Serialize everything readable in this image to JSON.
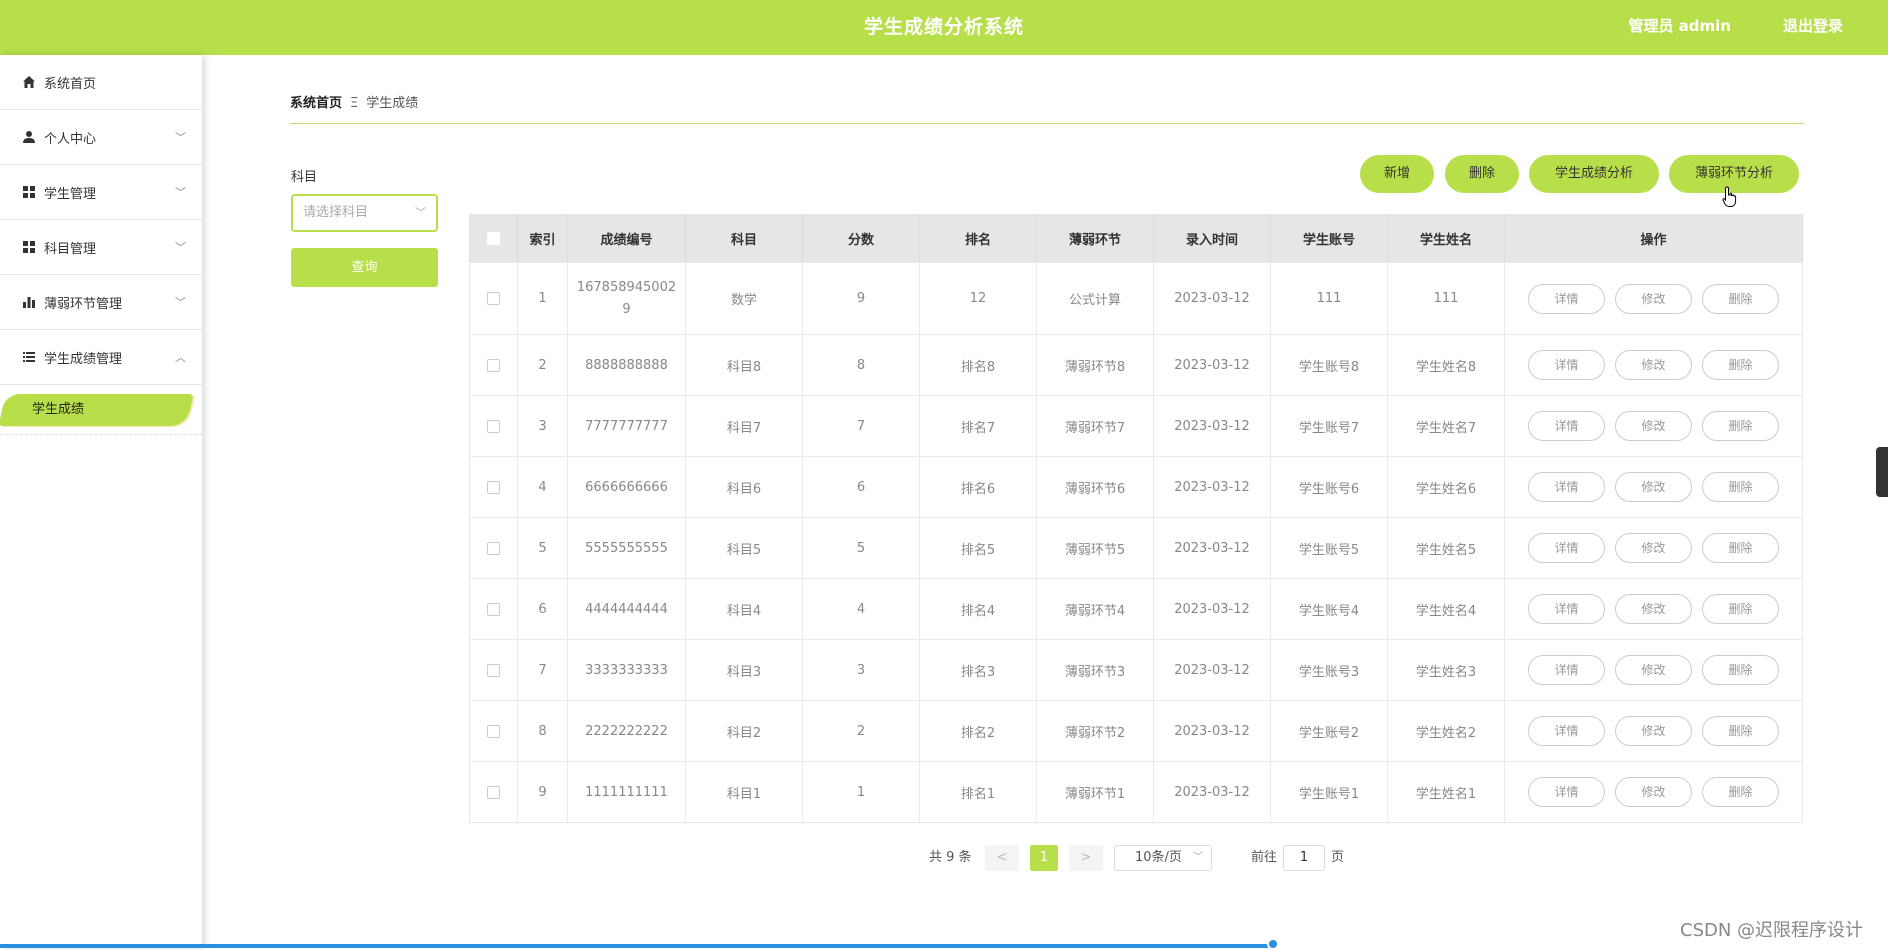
{
  "header": {
    "title": "学生成绩分析系统",
    "user": "管理员 admin",
    "logout": "退出登录"
  },
  "sidebar": {
    "items": [
      {
        "label": "系统首页"
      },
      {
        "label": "个人中心"
      },
      {
        "label": "学生管理"
      },
      {
        "label": "科目管理"
      },
      {
        "label": "薄弱环节管理"
      },
      {
        "label": "学生成绩管理"
      }
    ],
    "active_sub": "学生成绩"
  },
  "breadcrumb": {
    "home": "系统首页",
    "sep": "Ξ",
    "current": "学生成绩"
  },
  "filter": {
    "label": "科目",
    "placeholder": "请选择科目",
    "query": "查询"
  },
  "actions": {
    "add": "新增",
    "delete": "删除",
    "analysis": "学生成绩分析",
    "weak": "薄弱环节分析"
  },
  "table": {
    "columns": [
      "索引",
      "成绩编号",
      "科目",
      "分数",
      "排名",
      "薄弱环节",
      "录入时间",
      "学生账号",
      "学生姓名",
      "操作"
    ],
    "row_actions": {
      "detail": "详情",
      "edit": "修改",
      "delete": "删除"
    },
    "rows": [
      [
        "1",
        "1678589450029",
        "数学",
        "9",
        "12",
        "公式计算",
        "2023-03-12",
        "111",
        "111"
      ],
      [
        "2",
        "8888888888",
        "科目8",
        "8",
        "排名8",
        "薄弱环节8",
        "2023-03-12",
        "学生账号8",
        "学生姓名8"
      ],
      [
        "3",
        "7777777777",
        "科目7",
        "7",
        "排名7",
        "薄弱环节7",
        "2023-03-12",
        "学生账号7",
        "学生姓名7"
      ],
      [
        "4",
        "6666666666",
        "科目6",
        "6",
        "排名6",
        "薄弱环节6",
        "2023-03-12",
        "学生账号6",
        "学生姓名6"
      ],
      [
        "5",
        "5555555555",
        "科目5",
        "5",
        "排名5",
        "薄弱环节5",
        "2023-03-12",
        "学生账号5",
        "学生姓名5"
      ],
      [
        "6",
        "4444444444",
        "科目4",
        "4",
        "排名4",
        "薄弱环节4",
        "2023-03-12",
        "学生账号4",
        "学生姓名4"
      ],
      [
        "7",
        "3333333333",
        "科目3",
        "3",
        "排名3",
        "薄弱环节3",
        "2023-03-12",
        "学生账号3",
        "学生姓名3"
      ],
      [
        "8",
        "2222222222",
        "科目2",
        "2",
        "排名2",
        "薄弱环节2",
        "2023-03-12",
        "学生账号2",
        "学生姓名2"
      ],
      [
        "9",
        "1111111111",
        "科目1",
        "1",
        "排名1",
        "薄弱环节1",
        "2023-03-12",
        "学生账号1",
        "学生姓名1"
      ]
    ]
  },
  "pagination": {
    "total": "共 9 条",
    "prev": "<",
    "page": "1",
    "next": ">",
    "page_size": "10条/页",
    "goto": "前往",
    "goto_value": "1",
    "page_unit": "页"
  },
  "watermark": "CSDN @迟限程序设计",
  "icons": {
    "home": "home-icon",
    "user": "user-icon",
    "grid": "grid-icon",
    "bar": "bar-chart-icon",
    "list": "list-icon"
  },
  "colors": {
    "accent": "#b8de4a",
    "scrollbar": "#2a8fde"
  }
}
